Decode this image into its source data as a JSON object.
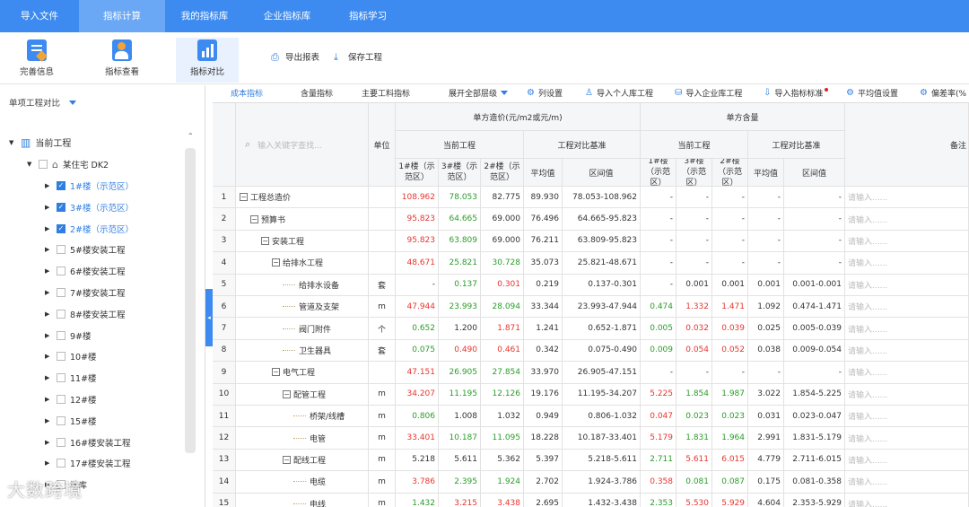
{
  "nav": {
    "tabs": [
      {
        "label": "导入文件",
        "active": false
      },
      {
        "label": "指标计算",
        "active": true
      },
      {
        "label": "我的指标库",
        "active": false
      },
      {
        "label": "企业指标库",
        "active": false
      },
      {
        "label": "指标学习",
        "active": false
      }
    ]
  },
  "toolbar": {
    "complete_info": "完善信息",
    "index_view": "指标查看",
    "index_compare": "指标对比",
    "export_report": "导出报表",
    "save_project": "保存工程"
  },
  "sidebar": {
    "compare_mode": "单项工程对比",
    "root_label": "当前工程",
    "project_label": "某住宅 DK2",
    "items": [
      {
        "label": "1#楼（示范区）",
        "checked": true
      },
      {
        "label": "3#楼（示范区）",
        "checked": true
      },
      {
        "label": "2#楼（示范区）",
        "checked": true
      },
      {
        "label": "5#楼安装工程",
        "checked": false
      },
      {
        "label": "6#楼安装工程",
        "checked": false
      },
      {
        "label": "7#楼安装工程",
        "checked": false
      },
      {
        "label": "8#楼安装工程",
        "checked": false
      },
      {
        "label": "9#楼",
        "checked": false
      },
      {
        "label": "10#楼",
        "checked": false
      },
      {
        "label": "11#楼",
        "checked": false
      },
      {
        "label": "12#楼",
        "checked": false
      },
      {
        "label": "15#楼",
        "checked": false
      },
      {
        "label": "16#楼安装工程",
        "checked": false
      },
      {
        "label": "17#楼安装工程",
        "checked": false
      },
      {
        "label": "地库",
        "checked": false
      }
    ]
  },
  "watermark": "大数跨境",
  "subtabs": {
    "cost_index": "成本指标",
    "content_index": "含量指标",
    "main_material_index": "主要工料指标",
    "expand_all": "展开全部层级",
    "column_settings": "列设置",
    "import_personal": "导入个人库工程",
    "import_enterprise": "导入企业库工程",
    "import_standard": "导入指标标准",
    "average_settings": "平均值设置",
    "deviation_rate": "偏差率(%"
  },
  "table": {
    "search_placeholder": "输入关键字查找...",
    "unit_header": "单位",
    "unit_cost_header": "单方造价(元/m2或元/m)",
    "unit_content_header": "单方含量",
    "current_project": "当前工程",
    "compare_baseline": "工程对比基准",
    "remark_header": "备注",
    "col_b1": "1#楼（示范区）",
    "col_b3": "3#楼（示范区）",
    "col_b2": "2#楼（示范区）",
    "avg": "平均值",
    "range": "区间值",
    "c_col_b1": "1#楼（示范区）",
    "c_col_b3": "3#楼（示范区）",
    "c_col_b2": "2#楼（示范区）",
    "c_avg": "平均值",
    "c_range": "区间值",
    "remark_placeholder": "请输入......",
    "rows": [
      {
        "no": "1",
        "name": "工程总造价",
        "unit": "",
        "b1": "108.962",
        "b3": "78.053",
        "b2": "82.775",
        "avg": "89.930",
        "range": "78.053-108.962",
        "cb1": "-",
        "cb3": "-",
        "cb2": "-",
        "cavg": "-",
        "crange": "-"
      },
      {
        "no": "2",
        "name": "预算书",
        "unit": "",
        "b1": "95.823",
        "b3": "64.665",
        "b2": "69.000",
        "avg": "76.496",
        "range": "64.665-95.823",
        "cb1": "-",
        "cb3": "-",
        "cb2": "-",
        "cavg": "-",
        "crange": "-"
      },
      {
        "no": "3",
        "name": "安装工程",
        "unit": "",
        "b1": "95.823",
        "b3": "63.809",
        "b2": "69.000",
        "avg": "76.211",
        "range": "63.809-95.823",
        "cb1": "-",
        "cb3": "-",
        "cb2": "-",
        "cavg": "-",
        "crange": "-"
      },
      {
        "no": "4",
        "name": "给排水工程",
        "unit": "",
        "b1": "48.671",
        "b3": "25.821",
        "b2": "30.728",
        "avg": "35.073",
        "range": "25.821-48.671",
        "cb1": "-",
        "cb3": "-",
        "cb2": "-",
        "cavg": "-",
        "crange": "-"
      },
      {
        "no": "5",
        "name": "给排水设备",
        "unit": "套",
        "b1": "-",
        "b3": "0.137",
        "b2": "0.301",
        "avg": "0.219",
        "range": "0.137-0.301",
        "cb1": "-",
        "cb3": "0.001",
        "cb2": "0.001",
        "cavg": "0.001",
        "crange": "0.001-0.001"
      },
      {
        "no": "6",
        "name": "管道及支架",
        "unit": "m",
        "b1": "47.944",
        "b3": "23.993",
        "b2": "28.094",
        "avg": "33.344",
        "range": "23.993-47.944",
        "cb1": "0.474",
        "cb3": "1.332",
        "cb2": "1.471",
        "cavg": "1.092",
        "crange": "0.474-1.471"
      },
      {
        "no": "7",
        "name": "阀门附件",
        "unit": "个",
        "b1": "0.652",
        "b3": "1.200",
        "b2": "1.871",
        "avg": "1.241",
        "range": "0.652-1.871",
        "cb1": "0.005",
        "cb3": "0.032",
        "cb2": "0.039",
        "cavg": "0.025",
        "crange": "0.005-0.039"
      },
      {
        "no": "8",
        "name": "卫生器具",
        "unit": "套",
        "b1": "0.075",
        "b3": "0.490",
        "b2": "0.461",
        "avg": "0.342",
        "range": "0.075-0.490",
        "cb1": "0.009",
        "cb3": "0.054",
        "cb2": "0.052",
        "cavg": "0.038",
        "crange": "0.009-0.054"
      },
      {
        "no": "9",
        "name": "电气工程",
        "unit": "",
        "b1": "47.151",
        "b3": "26.905",
        "b2": "27.854",
        "avg": "33.970",
        "range": "26.905-47.151",
        "cb1": "-",
        "cb3": "-",
        "cb2": "-",
        "cavg": "-",
        "crange": "-"
      },
      {
        "no": "10",
        "name": "配管工程",
        "unit": "m",
        "b1": "34.207",
        "b3": "11.195",
        "b2": "12.126",
        "avg": "19.176",
        "range": "11.195-34.207",
        "cb1": "5.225",
        "cb3": "1.854",
        "cb2": "1.987",
        "cavg": "3.022",
        "crange": "1.854-5.225"
      },
      {
        "no": "11",
        "name": "桥架/线槽",
        "unit": "m",
        "b1": "0.806",
        "b3": "1.008",
        "b2": "1.032",
        "avg": "0.949",
        "range": "0.806-1.032",
        "cb1": "0.047",
        "cb3": "0.023",
        "cb2": "0.023",
        "cavg": "0.031",
        "crange": "0.023-0.047"
      },
      {
        "no": "12",
        "name": "电管",
        "unit": "m",
        "b1": "33.401",
        "b3": "10.187",
        "b2": "11.095",
        "avg": "18.228",
        "range": "10.187-33.401",
        "cb1": "5.179",
        "cb3": "1.831",
        "cb2": "1.964",
        "cavg": "2.991",
        "crange": "1.831-5.179"
      },
      {
        "no": "13",
        "name": "配线工程",
        "unit": "m",
        "b1": "5.218",
        "b3": "5.611",
        "b2": "5.362",
        "avg": "5.397",
        "range": "5.218-5.611",
        "cb1": "2.711",
        "cb3": "5.611",
        "cb2": "6.015",
        "cavg": "4.779",
        "crange": "2.711-6.015"
      },
      {
        "no": "14",
        "name": "电缆",
        "unit": "m",
        "b1": "3.786",
        "b3": "2.395",
        "b2": "1.924",
        "avg": "2.702",
        "range": "1.924-3.786",
        "cb1": "0.358",
        "cb3": "0.081",
        "cb2": "0.087",
        "cavg": "0.175",
        "crange": "0.081-0.358"
      },
      {
        "no": "15",
        "name": "电线",
        "unit": "m",
        "b1": "1.432",
        "b3": "3.215",
        "b2": "3.438",
        "avg": "2.695",
        "range": "1.432-3.438",
        "cb1": "2.353",
        "cb3": "5.530",
        "cb2": "5.929",
        "cavg": "4.604",
        "crange": "2.353-5.929"
      }
    ]
  },
  "colors": {
    "high": "#e8352e",
    "low": "#2a9d2a",
    "normal": "#333333",
    "accent": "#3d8bf0"
  }
}
